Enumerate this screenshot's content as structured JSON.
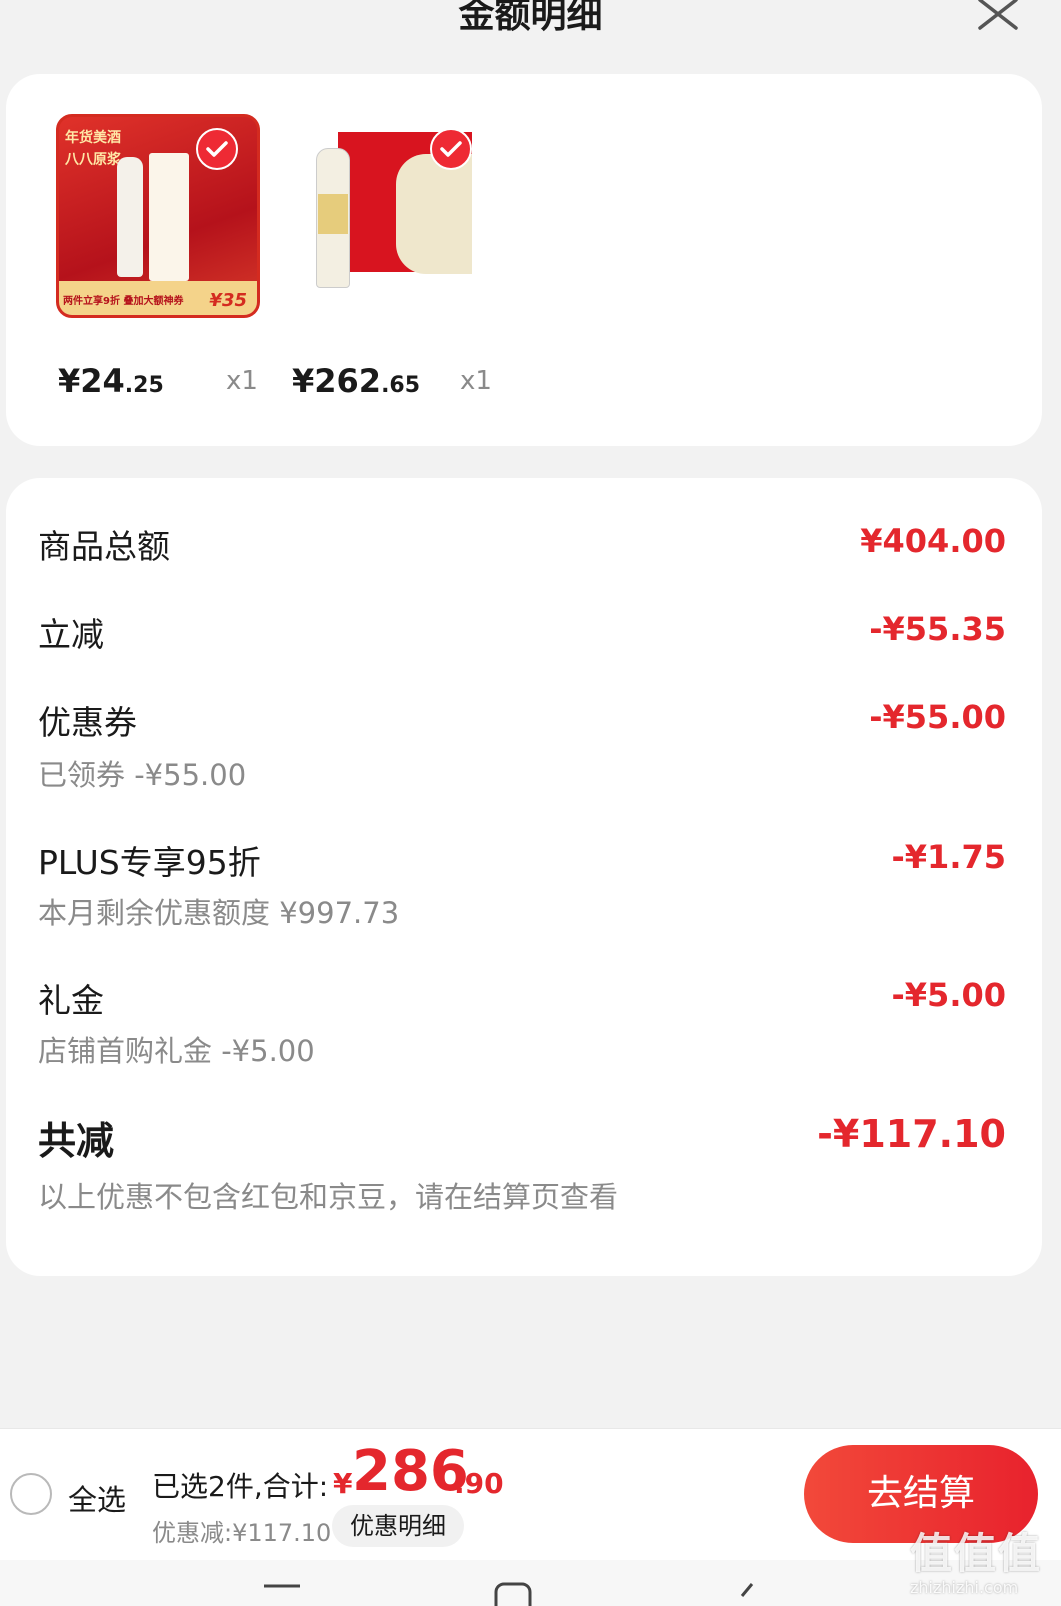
{
  "header": {
    "title": "金额明细"
  },
  "products": [
    {
      "price_int": "¥24",
      "price_dec": ".25",
      "qty": "x1",
      "thumb_text_1": "年货美酒",
      "thumb_text_2": "八八原浆",
      "thumb_promo": "两件立享9折 叠加大额神券",
      "thumb_badge": "¥35"
    },
    {
      "price_int": "¥262",
      "price_dec": ".65",
      "qty": "x1"
    }
  ],
  "summary": {
    "goods_total_label": "商品总额",
    "goods_total_value": "¥404.00",
    "instant_label": "立减",
    "instant_value": "-¥55.35",
    "coupon_label": "优惠券",
    "coupon_value": "-¥55.00",
    "coupon_sub": "已领券 -¥55.00",
    "plus_label": "PLUS专享95折",
    "plus_value": "-¥1.75",
    "plus_sub": "本月剩余优惠额度 ¥997.73",
    "gift_label": "礼金",
    "gift_value": "-¥5.00",
    "gift_sub": "店铺首购礼金 -¥5.00",
    "total_label": "共减",
    "total_value": "-¥117.10",
    "total_note": "以上优惠不包含红包和京豆，请在结算页查看"
  },
  "footer": {
    "select_all": "全选",
    "selected_label": "已选2件,合计:",
    "currency": "¥",
    "sum_int": "286",
    "sum_dec": ".90",
    "discount_label": "优惠减:¥117.10",
    "detail_button": "优惠明细",
    "checkout_button": "去结算"
  },
  "watermark": {
    "mark": "值值值",
    "url": "zhizhizhi.com"
  },
  "colors": {
    "accent": "#e4272d",
    "background": "#f2f2f2",
    "card": "#ffffff"
  }
}
